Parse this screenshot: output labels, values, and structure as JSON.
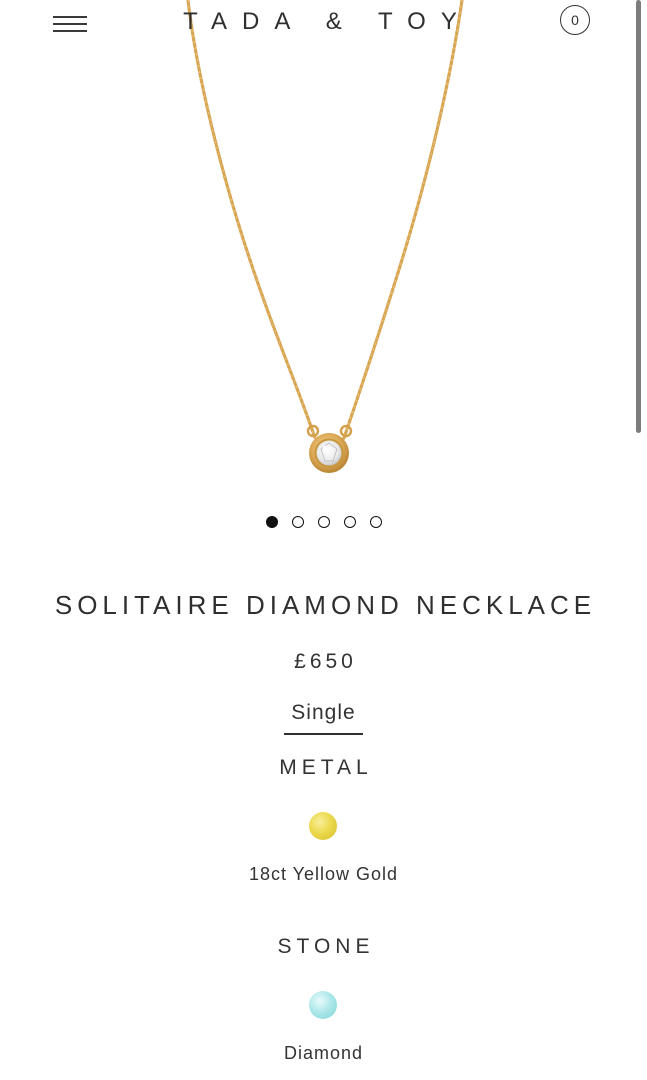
{
  "header": {
    "brand": "TADA & TOY",
    "cart_count": "0"
  },
  "carousel": {
    "slides": 5,
    "active_index": 0
  },
  "product": {
    "title": "SOLITAIRE DIAMOND NECKLACE",
    "price": "£650",
    "variant_tab": "Single",
    "metal": {
      "heading": "METAL",
      "option_label": "18ct Yellow Gold",
      "swatch_color": "#e8d44a"
    },
    "stone": {
      "heading": "STONE",
      "option_label": "Diamond",
      "swatch_color": "#a9e6e8"
    }
  },
  "colors": {
    "text": "#2f2f2f",
    "chain_gold": "#d9a64e",
    "background": "#ffffff"
  }
}
